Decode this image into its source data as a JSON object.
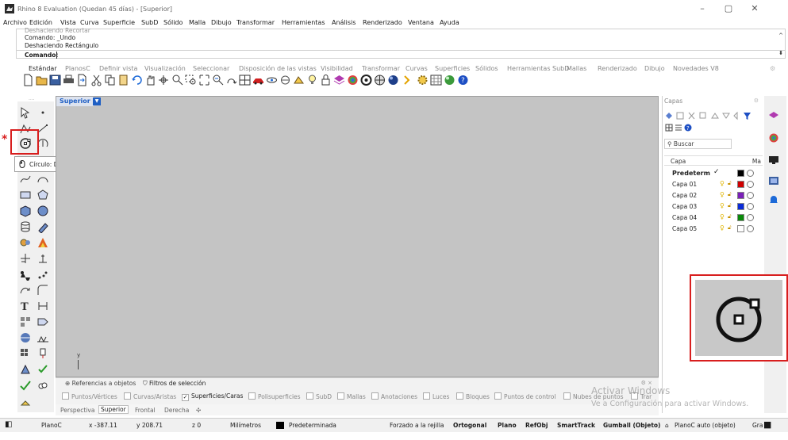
{
  "window": {
    "title": "Rhino 8 Evaluation (Quedan 45 días) - [Superior]",
    "controls": [
      "minimize",
      "maximize",
      "close"
    ]
  },
  "menu": [
    "Archivo",
    "Edición",
    "Vista",
    "Curva",
    "Superficie",
    "SubD",
    "Sólido",
    "Malla",
    "Dibujo",
    "Transformar",
    "Herramientas",
    "Análisis",
    "Renderizado",
    "Ventana",
    "Ayuda"
  ],
  "command_history": {
    "partial": "Deshaciendo Recortar",
    "lines": [
      "Comando: _Undo",
      "Deshaciendo Rectángulo"
    ],
    "prompt": "Comando:",
    "input_value": ""
  },
  "toolbar_tabs": [
    "Estándar",
    "PlanosC",
    "Definir vista",
    "Visualización",
    "Seleccionar",
    "Disposición de las vistas",
    "Visibilidad",
    "Transformar",
    "Curvas",
    "Superficies",
    "Sólidos",
    "Herramientas SubD",
    "Mallas",
    "Renderizado",
    "Dibujo",
    "Novedades V8"
  ],
  "active_toolbar_tab": "Estándar",
  "main_toolbar_icons": [
    "new-file",
    "open",
    "save",
    "print",
    "import",
    "cut",
    "copy",
    "paste",
    "undo",
    "pan",
    "rotate",
    "zoom",
    "zoom-window",
    "zoom-extents",
    "zoom-selected",
    "four-viewports",
    "car",
    "eye-hide",
    "circle-plane",
    "cplane",
    "light",
    "lock",
    "layer",
    "color-wheel",
    "material",
    "render-mesh",
    "render-sphere",
    "snap",
    "gear",
    "grid",
    "sphere",
    "help"
  ],
  "left_toolbar": {
    "icons": [
      "select-arrow",
      "point",
      "polyline",
      "line-segments",
      "circle-center-radius",
      "rotate-view",
      "curve",
      "arc",
      "rectangle",
      "polygon",
      "box",
      "sphere",
      "cylinder",
      "extrude",
      "fillet",
      "boolean",
      "move",
      "copy-move",
      "mesh",
      "explode",
      "text",
      "dimension",
      "arrow-curve",
      "fillet-curve",
      "grid-array",
      "block",
      "sphere-mesh",
      "truss",
      "group",
      "pin",
      "gumball",
      "checkmark-select",
      "cloud"
    ],
    "highlighted": "circle-center-radius",
    "marker": "*"
  },
  "tooltip": {
    "text": "Círculo: Desde centro y radio"
  },
  "viewport": {
    "name": "Superior",
    "axis_label": "y"
  },
  "bottom_panel": {
    "tabs": [
      "Referencias a objetos",
      "Filtros de selección"
    ],
    "active_tab": "Filtros de selección",
    "filters": [
      {
        "label": "Puntos/Vértices",
        "checked": false
      },
      {
        "label": "Curvas/Aristas",
        "checked": false
      },
      {
        "label": "Superficies/Caras",
        "checked": true
      },
      {
        "label": "Polisuperficies",
        "checked": false
      },
      {
        "label": "SubD",
        "checked": false
      },
      {
        "label": "Mallas",
        "checked": false
      },
      {
        "label": "Anotaciones",
        "checked": false
      },
      {
        "label": "Luces",
        "checked": false
      },
      {
        "label": "Bloques",
        "checked": false
      },
      {
        "label": "Puntos de control",
        "checked": false
      },
      {
        "label": "Nubes de puntos",
        "checked": false
      },
      {
        "label": "Trar",
        "checked": false
      }
    ]
  },
  "view_tabs": [
    "Perspectiva",
    "Superior",
    "Frontal",
    "Derecha"
  ],
  "active_view_tab": "Superior",
  "status": {
    "plane": "PlanoC",
    "x": "x -387.11",
    "y": "y 208.71",
    "z": "z 0",
    "units": "Milímetros",
    "layer": "Predeterminada",
    "items": [
      "Forzado a la rejilla",
      "Ortogonal",
      "Plano",
      "RefObj",
      "SmartTrack",
      "Gumball (Objeto)"
    ],
    "bold_items": [
      "Ortogonal",
      "Plano",
      "RefObj",
      "SmartTrack",
      "Gumball (Objeto)"
    ],
    "planoc_auto": "PlanoC auto (objeto)",
    "trailing": "Gra"
  },
  "layers_panel": {
    "title": "Capas",
    "search_placeholder": "Buscar",
    "column_name": "Capa",
    "column_material": "Ma",
    "layers": [
      {
        "name": "Predeterm",
        "current": true,
        "color": "#000000"
      },
      {
        "name": "Capa 01",
        "current": false,
        "color": "#d00000"
      },
      {
        "name": "Capa 02",
        "current": false,
        "color": "#7a1fb8"
      },
      {
        "name": "Capa 03",
        "current": false,
        "color": "#0a2bd8"
      },
      {
        "name": "Capa 04",
        "current": false,
        "color": "#0a8a0a"
      },
      {
        "name": "Capa 05",
        "current": false,
        "color": "#ffffff"
      }
    ]
  },
  "watermark": {
    "line1": "Activar Windows",
    "line2": "Ve a Configuración para activar Windows."
  },
  "colors": {
    "highlight_red": "#d81e1e",
    "viewport_gray": "#c4c4c4",
    "active_blue": "#1f5fc4"
  }
}
